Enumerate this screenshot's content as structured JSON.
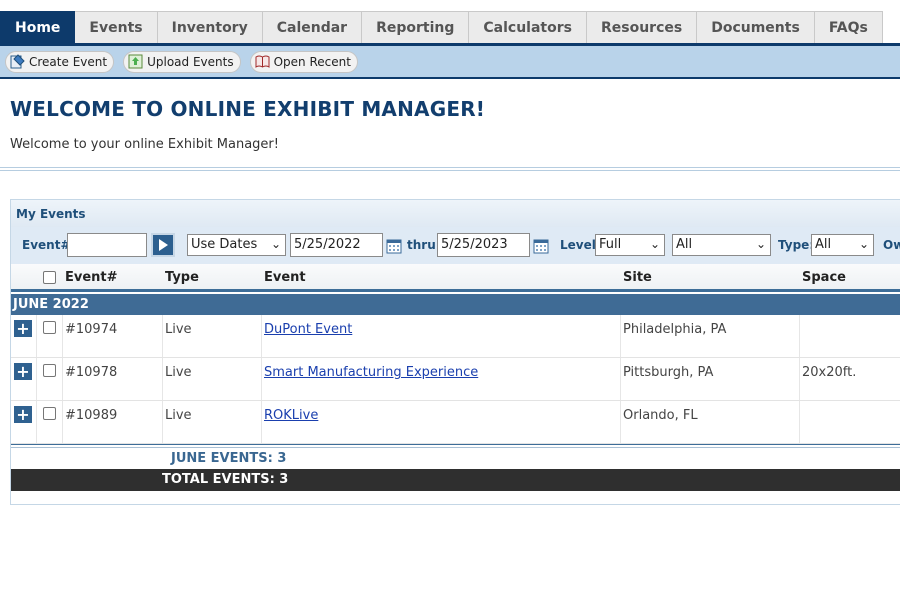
{
  "nav": {
    "tabs": [
      {
        "label": "Home",
        "active": true
      },
      {
        "label": "Events"
      },
      {
        "label": "Inventory"
      },
      {
        "label": "Calendar"
      },
      {
        "label": "Reporting"
      },
      {
        "label": "Calculators"
      },
      {
        "label": "Resources"
      },
      {
        "label": "Documents"
      },
      {
        "label": "FAQs"
      }
    ]
  },
  "toolbar": {
    "create_event": "Create Event",
    "upload_events": "Upload Events",
    "open_recent": "Open Recent"
  },
  "welcome": {
    "title": "WELCOME TO ONLINE EXHIBIT MANAGER!",
    "text": "Welcome to your online Exhibit Manager!"
  },
  "events": {
    "panel_title": "My Events",
    "filters": {
      "event_no_label": "Event#:",
      "event_no_value": "",
      "date_mode": "Use Dates",
      "date_from": "5/25/2022",
      "thru_label": "thru",
      "date_to": "5/25/2023",
      "level_label": "Level:",
      "level_value": "Full",
      "scope_value": "All",
      "type_label": "Type:",
      "type_value": "All",
      "owner_label": "Ow"
    },
    "columns": {
      "event_no": "Event#",
      "type": "Type",
      "event": "Event",
      "site": "Site",
      "space": "Space"
    },
    "group_label": "JUNE 2022",
    "rows": [
      {
        "event_no": "#10974",
        "type": "Live",
        "event": "DuPont Event",
        "site": "Philadelphia, PA",
        "space": ""
      },
      {
        "event_no": "#10978",
        "type": "Live",
        "event": "Smart Manufacturing Experience",
        "site": "Pittsburgh, PA",
        "space": "20x20ft."
      },
      {
        "event_no": "#10989",
        "type": "Live",
        "event": "ROKLive",
        "site": "Orlando, FL",
        "space": ""
      }
    ],
    "month_total": "JUNE EVENTS: 3",
    "grand_total": "TOTAL EVENTS: 3"
  },
  "colors": {
    "nav_active": "#0d3a6b",
    "toolbar_bg": "#b9d3ea",
    "title": "#123e6e",
    "group_bar": "#3f6b95",
    "total_bar": "#2f2f2f",
    "link": "#1a3fae"
  }
}
